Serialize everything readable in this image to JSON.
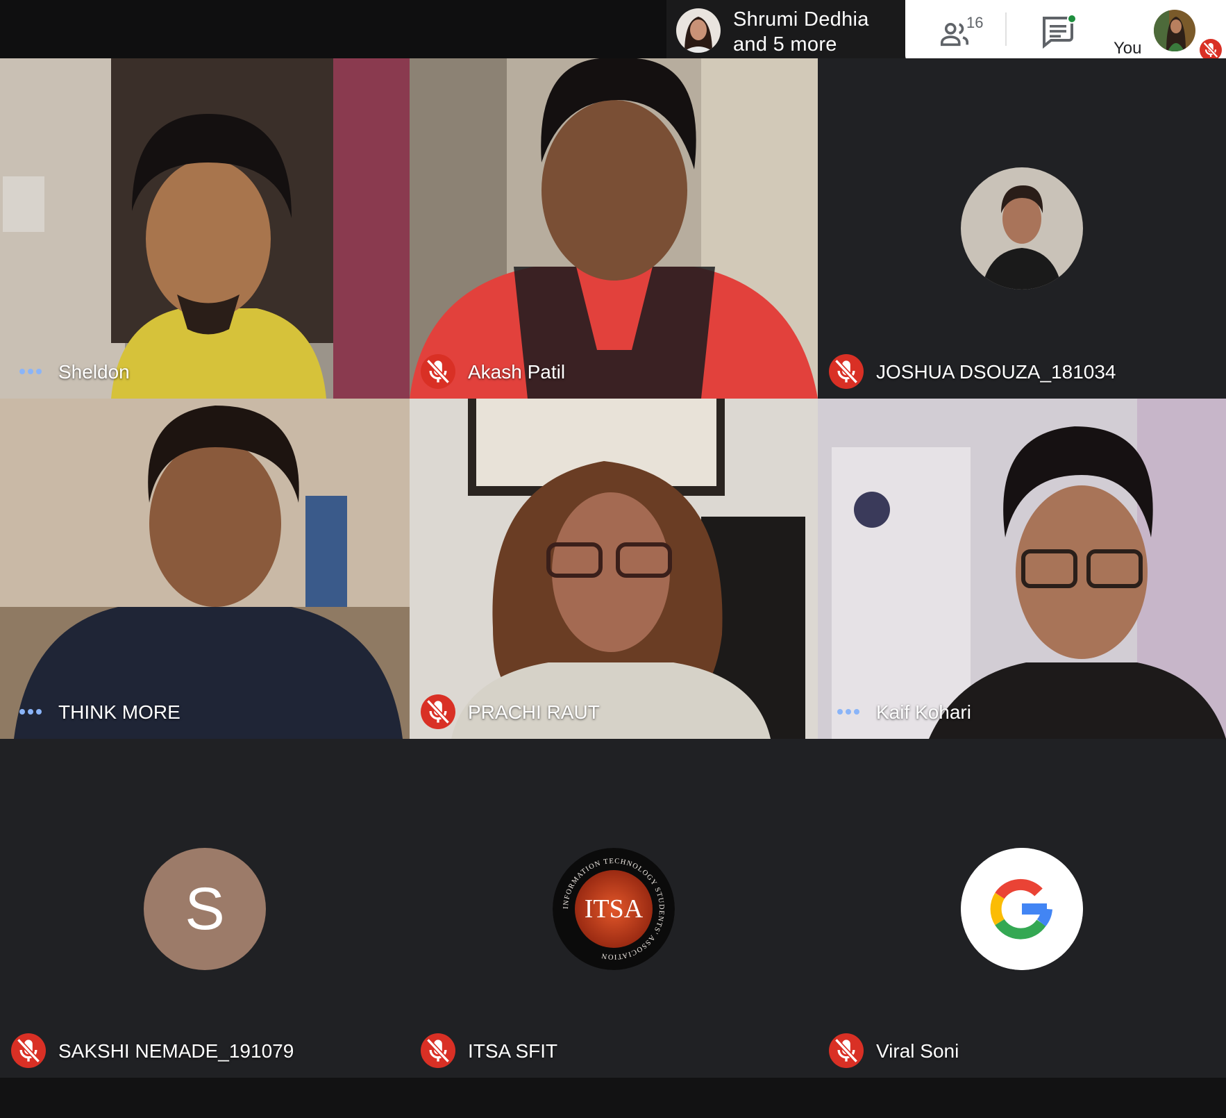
{
  "top_bar": {
    "presenter": {
      "name": "Shrumi Dedhia",
      "more": "and 5 more"
    },
    "people_count": "16",
    "self_label": "You"
  },
  "tiles": [
    {
      "name": "Sheldon",
      "status": "speaking-dots"
    },
    {
      "name": "Akash Patil",
      "status": "muted"
    },
    {
      "name": "JOSHUA DSOUZA_181034",
      "status": "muted"
    },
    {
      "name": "THINK MORE",
      "status": "speaking-dots"
    },
    {
      "name": "PRACHI RAUT",
      "status": "muted"
    },
    {
      "name": "Kaif Kohari",
      "status": "speaking-dots"
    },
    {
      "name": "SAKSHI NEMADE_191079",
      "status": "muted",
      "avatar_letter": "S"
    },
    {
      "name": "ITSA SFIT",
      "status": "muted",
      "logo_text": "ITSA",
      "logo_ring_text": "INFORMATION TECHNOLOGY STUDENTS' ASSOCIATION"
    },
    {
      "name": "Viral Soni",
      "status": "muted",
      "avatar_logo": "google-g"
    }
  ],
  "colors": {
    "background": "#202124",
    "mute_red": "#d93025",
    "dots_teal": "#8ab4f8",
    "avatar_s": "#9c7b69"
  }
}
